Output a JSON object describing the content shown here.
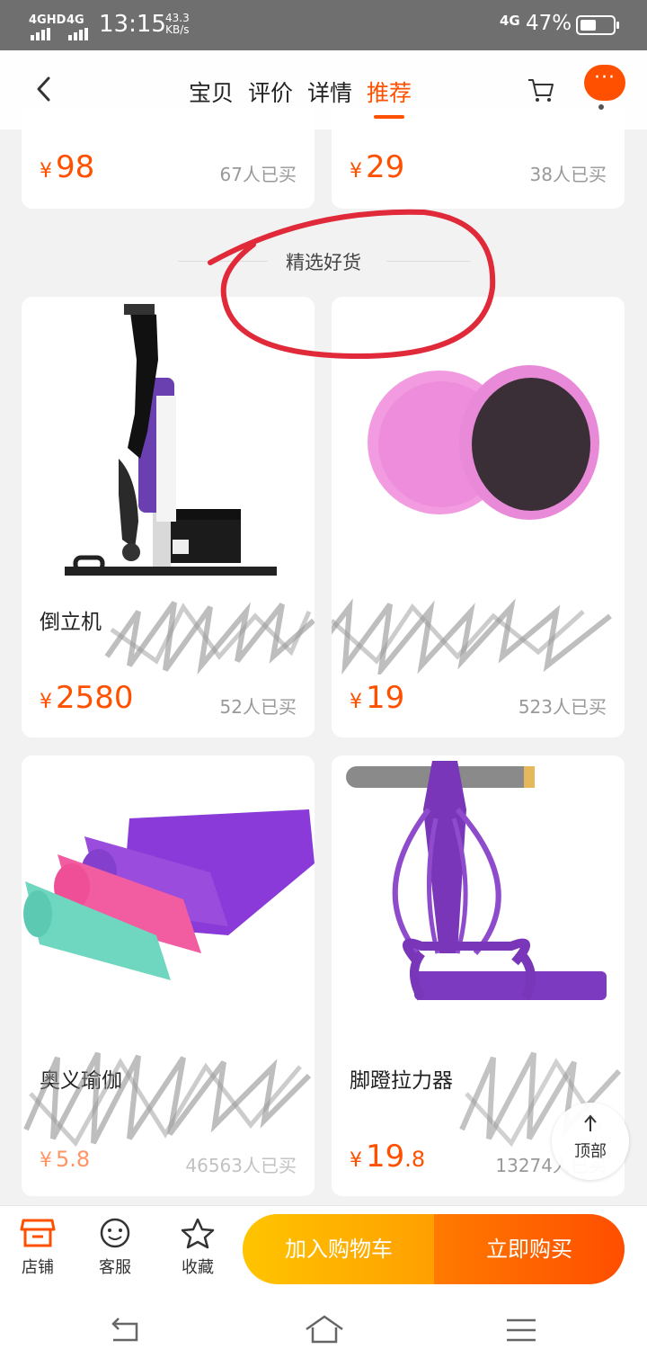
{
  "status": {
    "net1": "4GHD",
    "net2": "4G",
    "time": "13:15",
    "speed_value": "43.3",
    "speed_unit": "KB/s",
    "net3": "4G",
    "battery": "47%"
  },
  "nav": {
    "tabs": [
      "宝贝",
      "评价",
      "详情",
      "推荐"
    ],
    "active_tab": "推荐",
    "more": "···"
  },
  "prev_row": [
    {
      "currency": "¥",
      "price": "98",
      "sales": "67人已买"
    },
    {
      "currency": "¥",
      "price": "29",
      "sales": "38人已买"
    }
  ],
  "section": {
    "title": "精选好货"
  },
  "products": [
    {
      "title": "倒立机",
      "currency": "¥",
      "price": "2580",
      "sales": "52人已买"
    },
    {
      "title": "",
      "currency": "¥",
      "price": "19",
      "sales": "523人已买"
    },
    {
      "title": "奥义瑜伽",
      "currency": "¥",
      "price": "5.8",
      "sales": "46563人已买"
    },
    {
      "title": "脚蹬拉力器",
      "currency": "¥",
      "price": "19",
      "price_decimal": ".8",
      "sales": "13274人已买"
    }
  ],
  "top_button": {
    "label": "顶部"
  },
  "bottom_bar": {
    "shop": "店铺",
    "service": "客服",
    "favorite": "收藏",
    "add_cart": "加入购物车",
    "buy_now": "立即购买"
  },
  "colors": {
    "accent": "#ff5000",
    "cart_button": "#ffb300",
    "buy_button": "#ff5a00",
    "annotation_circle": "#e02a3a"
  }
}
